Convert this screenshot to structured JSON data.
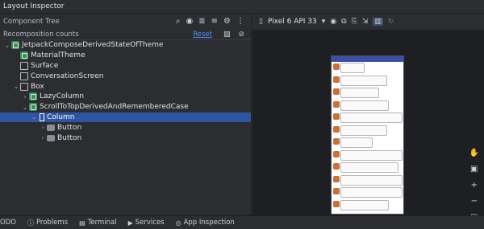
{
  "window": {
    "title": "Layout Inspector"
  },
  "component_tree": {
    "header": "Component Tree",
    "toolbar_icons": [
      "search-icon",
      "eye-icon",
      "expand-all-icon",
      "collapse-all-icon",
      "settings-icon",
      "more-icon"
    ],
    "recomposition_label": "Recomposition counts",
    "reset_label": "Reset",
    "nodes": [
      {
        "label": "JetpackComposeDerivedStateOfTheme",
        "depth": 0,
        "chevron": "expanded",
        "icon": "compose"
      },
      {
        "label": "MaterialTheme",
        "depth": 1,
        "chevron": "none",
        "icon": "compose"
      },
      {
        "label": "Surface",
        "depth": 1,
        "chevron": "none",
        "icon": "box"
      },
      {
        "label": "ConversationScreen",
        "depth": 1,
        "chevron": "none",
        "icon": "box"
      },
      {
        "label": "Box",
        "depth": 1,
        "chevron": "expanded",
        "icon": "box"
      },
      {
        "label": "LazyColumn",
        "depth": 2,
        "chevron": "collapsed",
        "icon": "compose"
      },
      {
        "label": "ScrollToTopDerivedAndRememberedCase",
        "depth": 2,
        "chevron": "expanded",
        "icon": "compose"
      },
      {
        "label": "Column",
        "depth": 3,
        "chevron": "expanded",
        "icon": "col",
        "selected": true
      },
      {
        "label": "Button",
        "depth": 4,
        "chevron": "collapsed",
        "icon": "btn"
      },
      {
        "label": "Button",
        "depth": 4,
        "chevron": "collapsed",
        "icon": "btn"
      }
    ]
  },
  "device_toolbar": {
    "device": "Pixel 6 API 33"
  },
  "status_bar": {
    "items": [
      {
        "label": "TODO",
        "icon": "list-icon"
      },
      {
        "label": "Problems",
        "icon": "problems-icon"
      },
      {
        "label": "Terminal",
        "icon": "terminal-icon"
      },
      {
        "label": "Services",
        "icon": "services-icon"
      },
      {
        "label": "App Inspection",
        "icon": "app-inspection-icon"
      }
    ]
  }
}
